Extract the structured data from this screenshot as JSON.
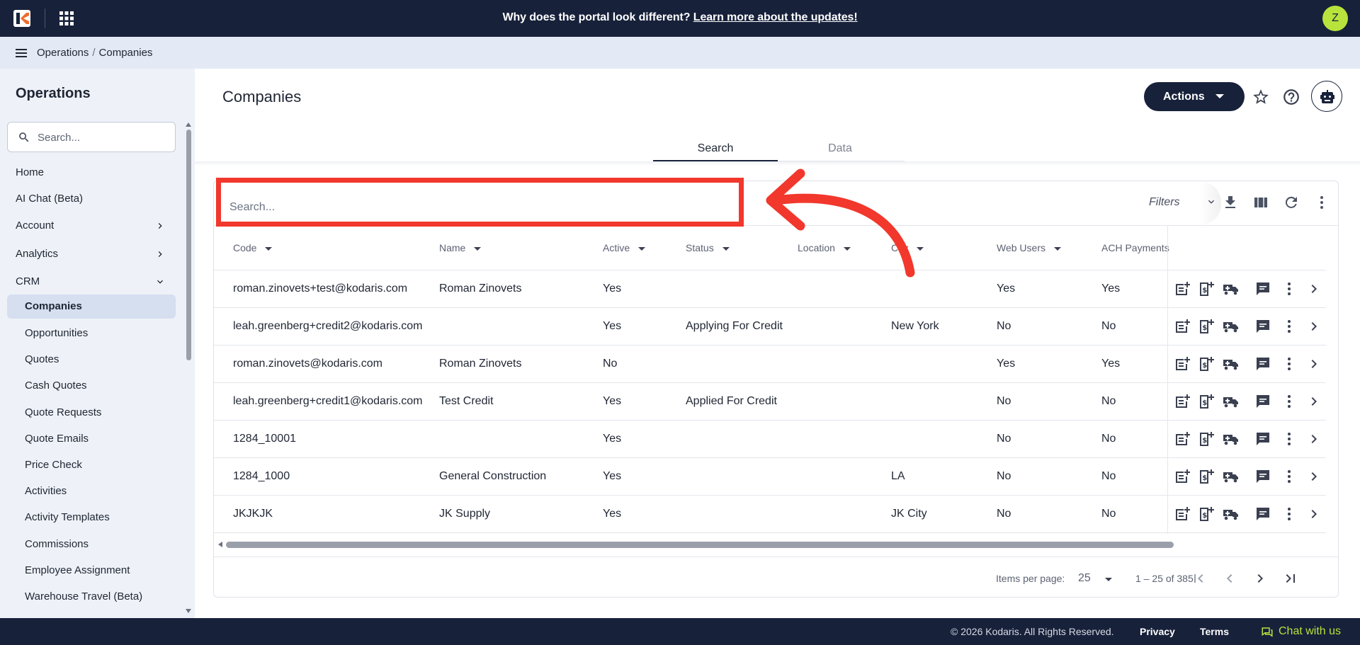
{
  "topbar": {
    "banner_text": "Why does the portal look different?",
    "banner_link": "Learn more about the updates!",
    "avatar_initial": "Z"
  },
  "breadcrumb": {
    "items": [
      "Operations",
      "Companies"
    ],
    "separator": "/"
  },
  "sidebar": {
    "title": "Operations",
    "search_placeholder": "Search...",
    "items": [
      {
        "label": "Home"
      },
      {
        "label": "AI Chat (Beta)"
      },
      {
        "label": "Account",
        "chevron": "right"
      },
      {
        "label": "Analytics",
        "chevron": "right"
      },
      {
        "label": "CRM",
        "chevron": "down"
      },
      {
        "label": "Companies",
        "active": true
      },
      {
        "label": "Opportunities"
      },
      {
        "label": "Quotes"
      },
      {
        "label": "Cash Quotes"
      },
      {
        "label": "Quote Requests"
      },
      {
        "label": "Quote Emails"
      },
      {
        "label": "Price Check"
      },
      {
        "label": "Activities"
      },
      {
        "label": "Activity Templates"
      },
      {
        "label": "Commissions"
      },
      {
        "label": "Employee Assignment"
      },
      {
        "label": "Warehouse Travel (Beta)"
      }
    ]
  },
  "page": {
    "title": "Companies",
    "actions_label": "Actions",
    "tabs": [
      "Search",
      "Data"
    ],
    "active_tab": "Search"
  },
  "table": {
    "search_placeholder": "Search...",
    "filters_label": "Filters",
    "columns": [
      "Code",
      "Name",
      "Active",
      "Status",
      "Location",
      "City",
      "Web Users",
      "ACH Payments"
    ],
    "rows": [
      {
        "code": "roman.zinovets+test@kodaris.com",
        "name": "Roman Zinovets",
        "active": "Yes",
        "status": "",
        "location": "",
        "city": "",
        "web_users": "Yes",
        "ach": "Yes"
      },
      {
        "code": "leah.greenberg+credit2@kodaris.com",
        "name": "",
        "active": "Yes",
        "status": "Applying For Credit",
        "location": "",
        "city": "New York",
        "web_users": "No",
        "ach": "No"
      },
      {
        "code": "roman.zinovets@kodaris.com",
        "name": "Roman Zinovets",
        "active": "No",
        "status": "",
        "location": "",
        "city": "",
        "web_users": "Yes",
        "ach": "Yes"
      },
      {
        "code": "leah.greenberg+credit1@kodaris.com",
        "name": "Test Credit",
        "active": "Yes",
        "status": "Applied For Credit",
        "location": "",
        "city": "",
        "web_users": "No",
        "ach": "No"
      },
      {
        "code": "1284_10001",
        "name": "",
        "active": "Yes",
        "status": "",
        "location": "",
        "city": "",
        "web_users": "No",
        "ach": "No"
      },
      {
        "code": "1284_1000",
        "name": "General Construction",
        "active": "Yes",
        "status": "",
        "location": "",
        "city": "LA",
        "web_users": "No",
        "ach": "No"
      },
      {
        "code": "JKJKJK",
        "name": "JK Supply",
        "active": "Yes",
        "status": "",
        "location": "",
        "city": "JK City",
        "web_users": "No",
        "ach": "No"
      }
    ],
    "row_action_icons": [
      "add-note-icon",
      "add-credit-icon",
      "shipping-truck-icon",
      "comment-icon",
      "more-vert-icon",
      "chevron-right-icon"
    ],
    "toolbar_icons": [
      "download-icon",
      "columns-icon",
      "refresh-icon",
      "more-vert-icon"
    ]
  },
  "pagination": {
    "items_per_page_label": "Items per page:",
    "items_per_page": "25",
    "range_label": "1 – 25 of 385"
  },
  "footer": {
    "copyright": "© 2026 Kodaris. All Rights Reserved.",
    "privacy": "Privacy",
    "terms": "Terms",
    "chat": "Chat with us"
  },
  "colors": {
    "navy": "#17213a",
    "accent_green": "#b7e33c",
    "annotation_red": "#f2372c",
    "sidebar_bg": "#eef2f8",
    "crumb_bg": "#e4eaf5"
  }
}
